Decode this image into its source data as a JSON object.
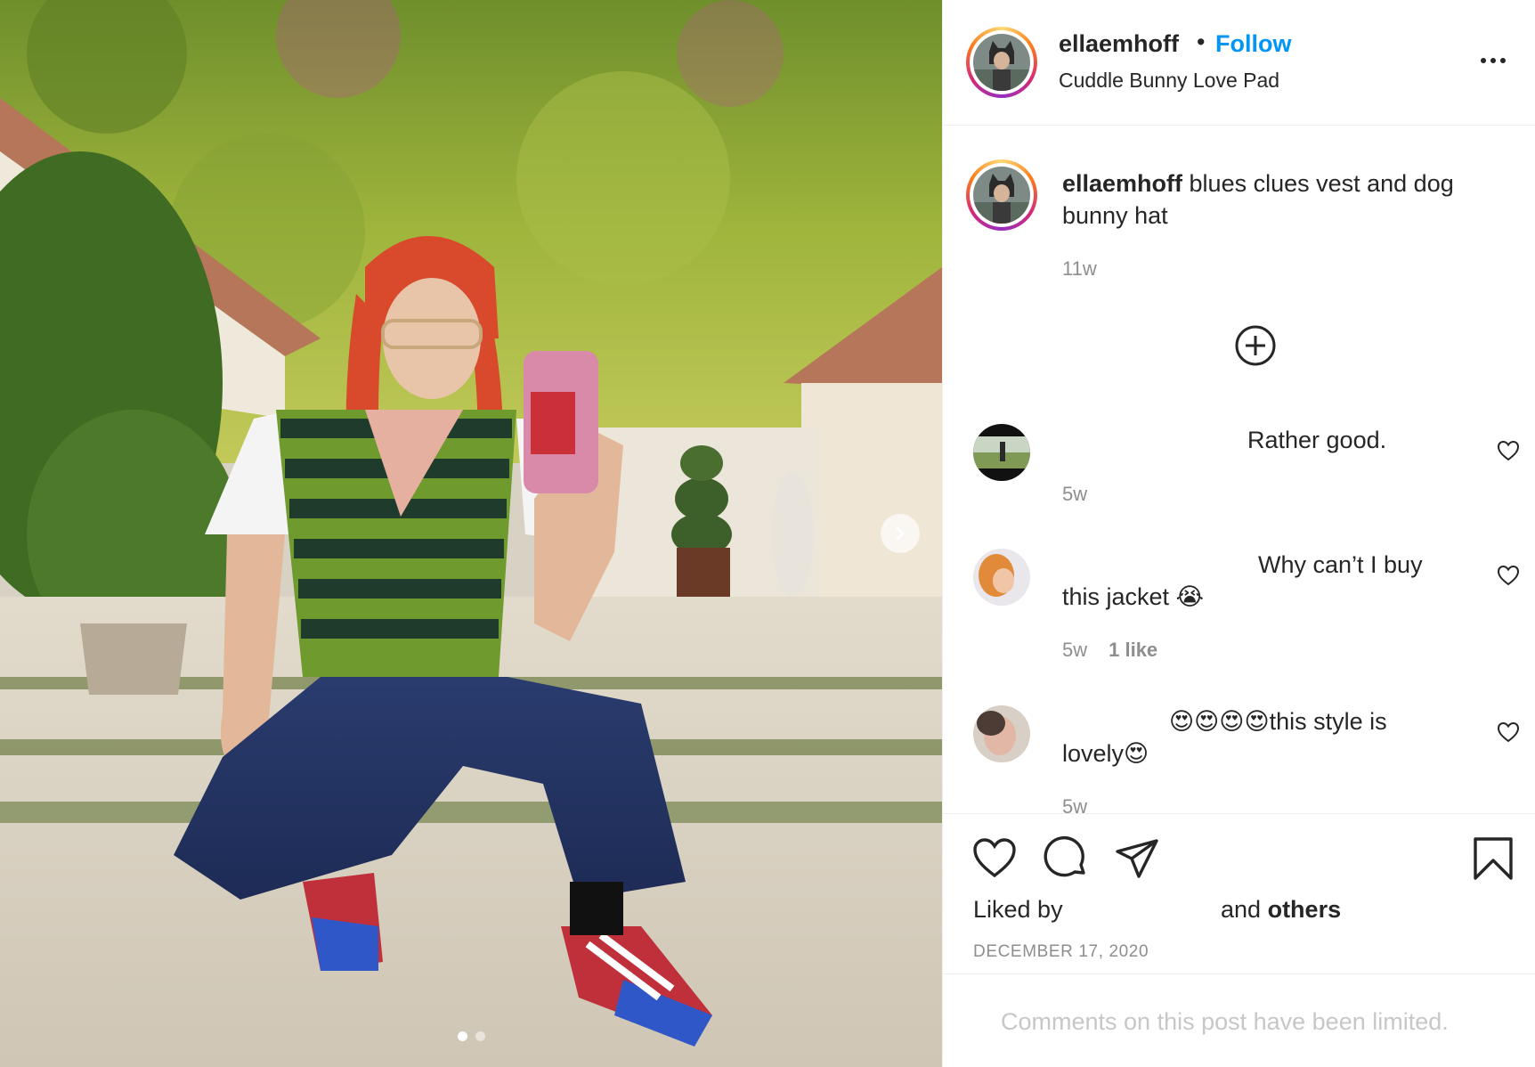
{
  "post": {
    "username": "ellaemhoff",
    "separator": "•",
    "follow_label": "Follow",
    "location": "Cuddle Bunny Love Pad",
    "more_icon": "more-options-icon"
  },
  "caption": {
    "username": "ellaemhoff",
    "text": " blues clues vest and dog",
    "text_line2": "bunny hat",
    "age": "11w"
  },
  "comments": [
    {
      "text": "Rather good.",
      "text_line2": "",
      "age": "5w",
      "likes": ""
    },
    {
      "text": "Why can’t I buy",
      "text_line2": "this jacket 😭",
      "age": "5w",
      "likes": "1 like"
    },
    {
      "text": "😍😍😍😍this style is",
      "text_line2": "lovely😍",
      "age": "5w",
      "likes": ""
    }
  ],
  "actions": {
    "like_icon": "heart-icon",
    "comment_icon": "comment-icon",
    "share_icon": "paper-plane-icon",
    "save_icon": "bookmark-icon"
  },
  "likes": {
    "prefix": "Liked by",
    "suffix_and": "and",
    "suffix_others": "others"
  },
  "date": "DECEMBER 17, 2020",
  "comments_limited": "Comments on this post have been limited.",
  "carousel": {
    "current": 1,
    "total": 2
  },
  "colors": {
    "follow_blue": "#0095f6",
    "text": "#262626",
    "muted": "#8e8e8e",
    "divider": "#efefef"
  }
}
